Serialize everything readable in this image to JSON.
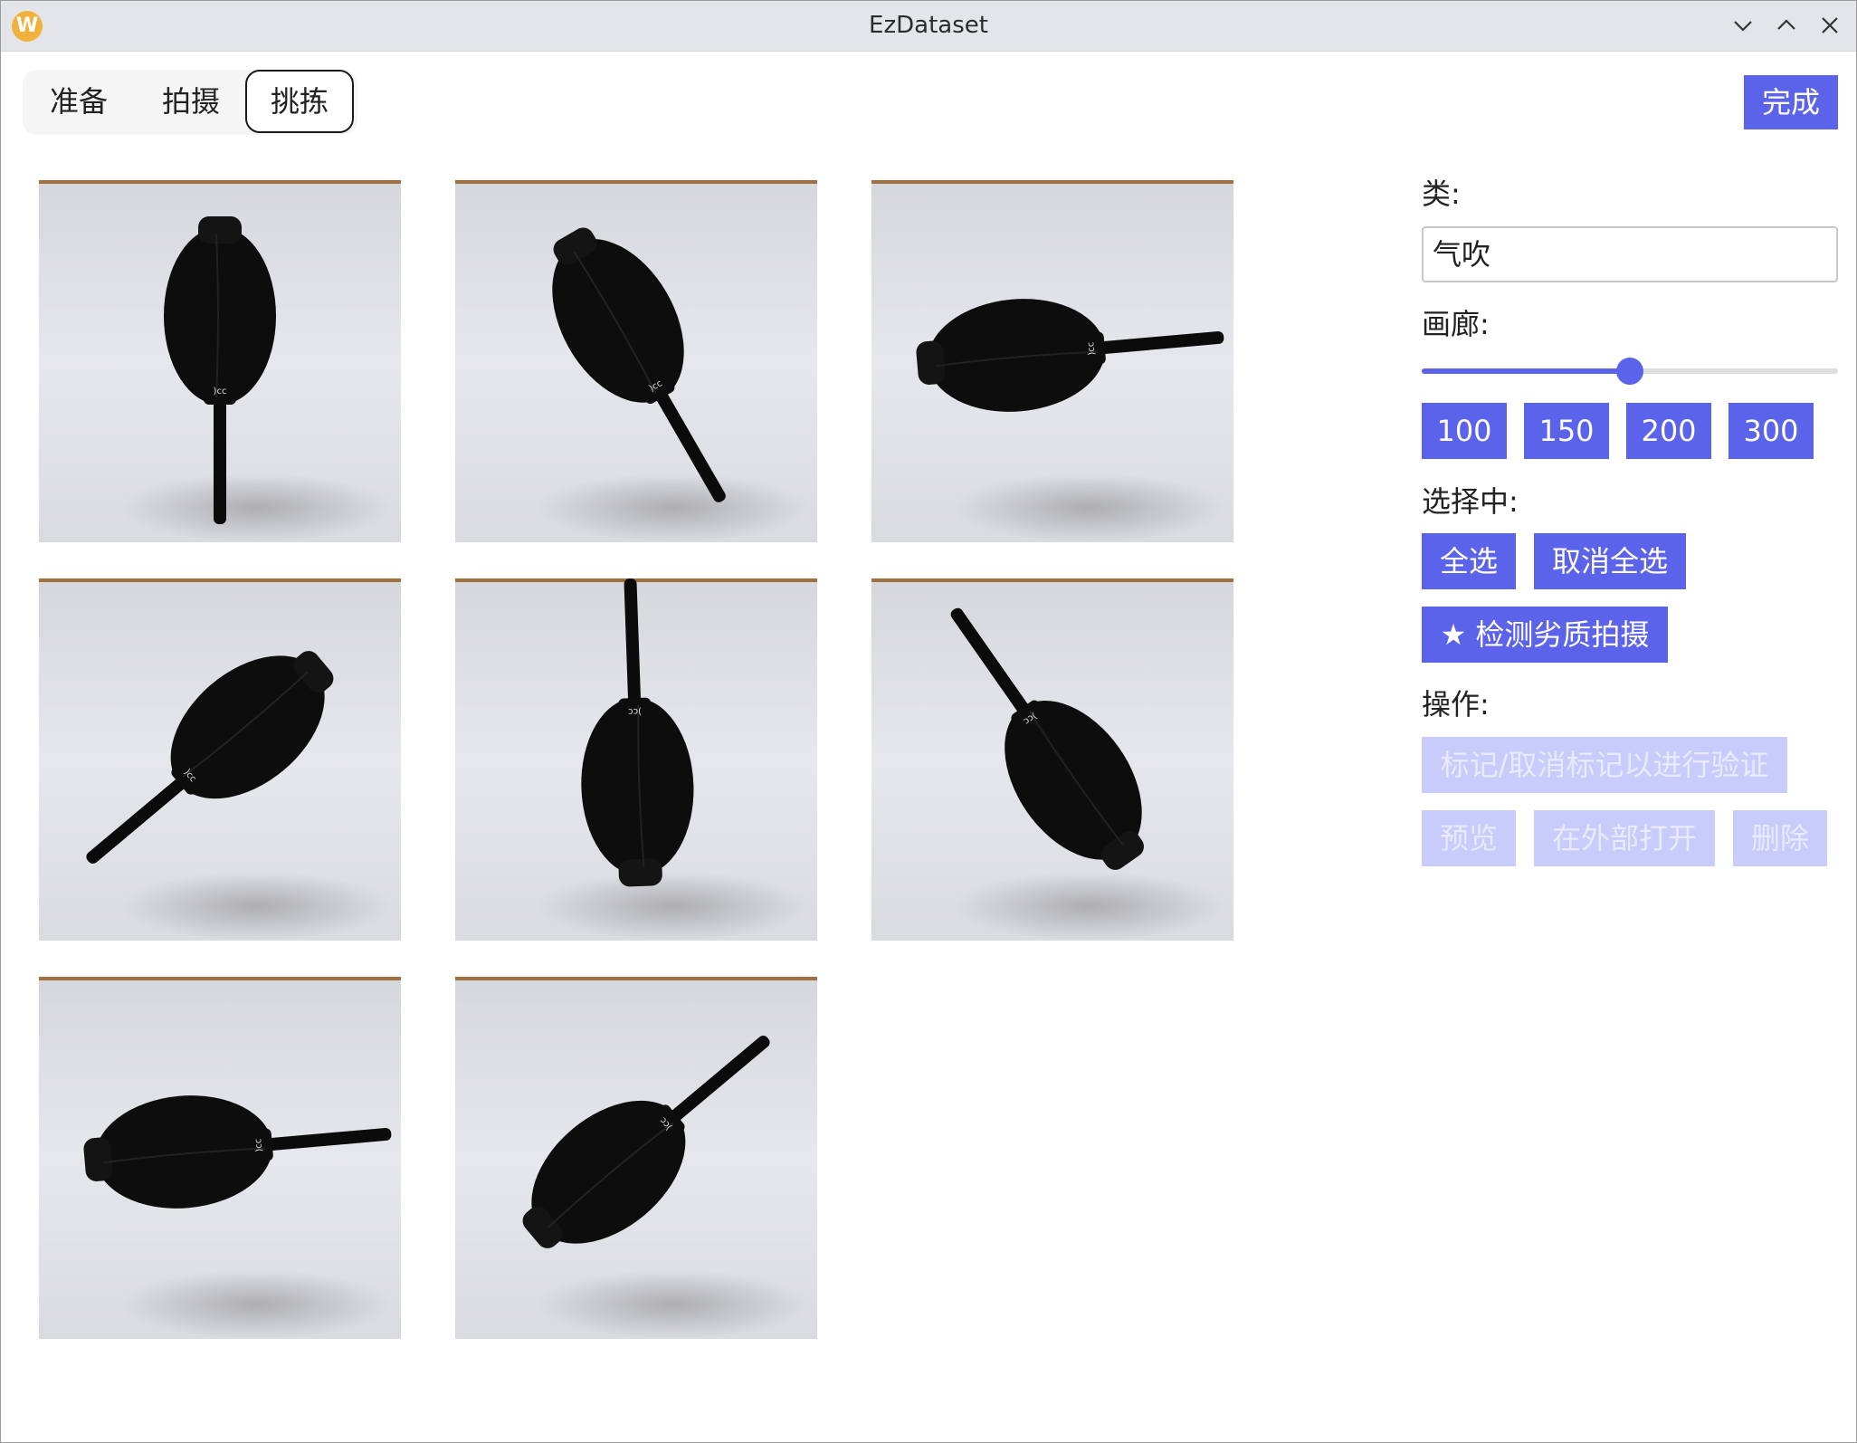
{
  "window": {
    "title": "EzDataset"
  },
  "tabs": [
    {
      "label": "准备",
      "active": false
    },
    {
      "label": "拍摄",
      "active": false
    },
    {
      "label": "挑拣",
      "active": true
    }
  ],
  "finish_button": "完成",
  "sidebar": {
    "class_label": "类:",
    "class_value": "气吹",
    "gallery_label": "画廊:",
    "gallery_slider_value": 0.5,
    "size_buttons": [
      "100",
      "150",
      "200",
      "300"
    ],
    "selecting_label": "选择中:",
    "select_all": "全选",
    "deselect_all": "取消全选",
    "detect_bad": "★ 检测劣质拍摄",
    "actions_label": "操作:",
    "mark_validation": "标记/取消标记以进行验证",
    "preview": "预览",
    "open_external": "在外部打开",
    "delete": "删除"
  },
  "gallery": {
    "images": [
      {
        "angle": 0
      },
      {
        "angle": -30
      },
      {
        "angle": -95
      },
      {
        "angle": 50
      },
      {
        "angle": 178
      },
      {
        "angle": 145
      },
      {
        "angle": -95
      },
      {
        "angle": -130
      }
    ]
  },
  "colors": {
    "accent": "#5b63ea",
    "accent_disabled": "#c9ccfa",
    "titlebar": "#e3e5e8",
    "logo": "#f0b23c"
  }
}
